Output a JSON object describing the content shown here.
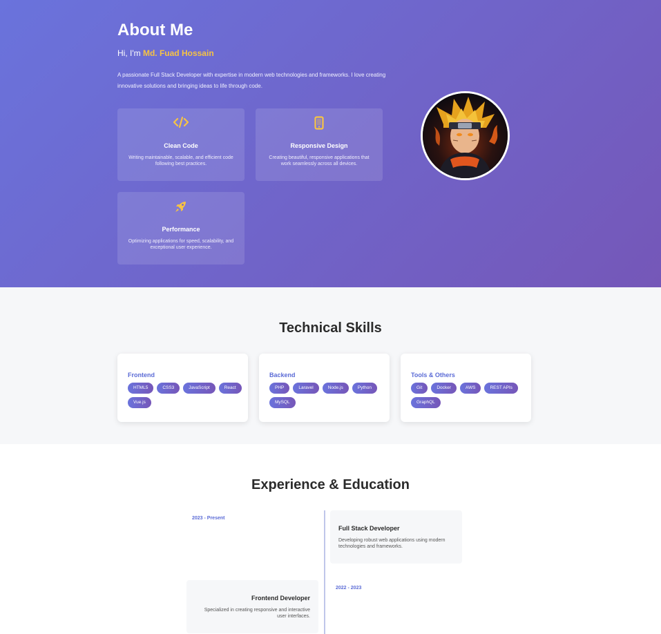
{
  "about": {
    "title": "About Me",
    "greeting_prefix": "Hi, I'm",
    "name": "Md. Fuad Hossain",
    "bio": "A passionate Full Stack Developer with expertise in modern web technologies and frameworks. I love creating innovative solutions and bringing ideas to life through code.",
    "cards": [
      {
        "icon": "code-icon",
        "title": "Clean Code",
        "desc": "Writing maintainable, scalable, and efficient code following best practices."
      },
      {
        "icon": "mobile-icon",
        "title": "Responsive Design",
        "desc": "Creating beautiful, responsive applications that work seamlessly across all devices."
      },
      {
        "icon": "rocket-icon",
        "title": "Performance",
        "desc": "Optimizing applications for speed, scalability, and exceptional user experience."
      }
    ]
  },
  "skills": {
    "title": "Technical Skills",
    "categories": [
      {
        "name": "Frontend",
        "tags": [
          "HTML5",
          "CSS3",
          "JavaScript",
          "React",
          "Vue.js"
        ]
      },
      {
        "name": "Backend",
        "tags": [
          "PHP",
          "Laravel",
          "Node.js",
          "Python",
          "MySQL"
        ]
      },
      {
        "name": "Tools & Others",
        "tags": [
          "Git",
          "Docker",
          "AWS",
          "REST APIs",
          "GraphQL"
        ]
      }
    ]
  },
  "experience": {
    "title": "Experience & Education",
    "items": [
      {
        "date": "2023 - Present",
        "title": "Full Stack Developer",
        "desc": "Developing robust web applications using modern technologies and frameworks."
      },
      {
        "date": "2022 - 2023",
        "title": "Frontend Developer",
        "desc": "Specialized in creating responsive and interactive user interfaces."
      }
    ]
  },
  "colors": {
    "accent": "#5b6bd6",
    "highlight": "#f6c344",
    "gradient_start": "#6a73dc",
    "gradient_end": "#7557b8"
  }
}
